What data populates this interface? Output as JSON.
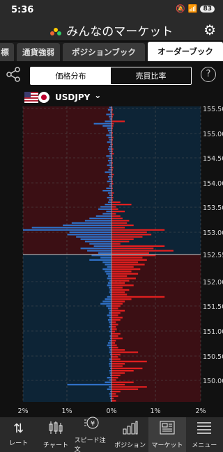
{
  "status": {
    "time": "5:36",
    "battery": "83"
  },
  "app": {
    "title": "みんなのマーケット"
  },
  "tabs": [
    {
      "label": "標"
    },
    {
      "label": "通貨強弱"
    },
    {
      "label": "ポジションブック"
    },
    {
      "label": "オーダーブック"
    }
  ],
  "segment": {
    "left": "価格分布",
    "right": "売買比率"
  },
  "pair": {
    "label": "USDJPY",
    "caret": "⌄"
  },
  "nav": [
    {
      "label": "レート",
      "icon": "rate-arrows-icon"
    },
    {
      "label": "チャート",
      "icon": "candlestick-icon"
    },
    {
      "label": "スピード注文",
      "icon": "yen-coin-icon"
    },
    {
      "label": "ポジション",
      "icon": "bars-icon"
    },
    {
      "label": "マーケット",
      "icon": "newspaper-icon"
    },
    {
      "label": "メニュー",
      "icon": "menu-icon"
    }
  ],
  "colors": {
    "sell_bar": "#2f6fc4",
    "buy_bar": "#e01f1f",
    "sell_bg_top": "#3b0f14",
    "sell_bg_bottom": "#0d2436"
  },
  "chart_data": {
    "type": "bar",
    "current_price": "152.55",
    "y_ticks": [
      "155.50",
      "155.00",
      "154.50",
      "154.00",
      "153.50",
      "153.00",
      "152.55",
      "152.00",
      "151.50",
      "151.00",
      "150.50",
      "150.00"
    ],
    "x_ticks": [
      "2%",
      "1%",
      "0%",
      "1%",
      "2%"
    ],
    "left_values": [
      0.05,
      0.08,
      0.03,
      0.12,
      0.06,
      0.04,
      0.15,
      0.4,
      0.2,
      0.1,
      0.08,
      0.05,
      0.12,
      0.07,
      0.05,
      0.1,
      0.03,
      0.06,
      0.08,
      0.05,
      0.04,
      0.12,
      0.06,
      0.08,
      0.05,
      0.1,
      0.04,
      0.07,
      0.15,
      0.05,
      0.08,
      0.06,
      0.1,
      0.04,
      0.05,
      0.12,
      0.2,
      0.08,
      0.05,
      0.1,
      0.06,
      0.08,
      0.15,
      0.25,
      0.3,
      0.12,
      0.2,
      0.35,
      0.5,
      0.6,
      0.9,
      1.1,
      1.8,
      2.0,
      0.95,
      1.0,
      0.8,
      0.7,
      0.6,
      0.5,
      0.4,
      0.7,
      0.55,
      0.3,
      0.45,
      0.25,
      0.5,
      0.2,
      0.15,
      0.1,
      0.2,
      0.15,
      0.12,
      0.08,
      0.1,
      0.05,
      0.08,
      0.1,
      0.06,
      0.04,
      0.05,
      0.03,
      0.1,
      0.15,
      0.2,
      0.25,
      0.12,
      0.08,
      0.05,
      0.06,
      0.1,
      0.05,
      0.08,
      0.06,
      0.04,
      0.06,
      0.03,
      0.05,
      0.02,
      0.04,
      0.03,
      0.05,
      0.08,
      0.1,
      0.06,
      0.04,
      0.05,
      0.03,
      0.02,
      0.05,
      0.04,
      0.06,
      0.05,
      0.03,
      0.05,
      0.04,
      0.03,
      0.1,
      0.05,
      0.15,
      1.0,
      0.06,
      0.1,
      0.03,
      0.05,
      0.04,
      0.03,
      0.02
    ],
    "right_values": [
      0.02,
      0.03,
      0.02,
      0.05,
      0.03,
      0.02,
      0.3,
      0.05,
      0.04,
      0.03,
      0.02,
      0.03,
      0.02,
      0.04,
      0.03,
      0.02,
      0.03,
      0.02,
      0.04,
      0.03,
      0.05,
      0.02,
      0.03,
      0.02,
      0.03,
      0.02,
      0.04,
      0.03,
      0.02,
      0.05,
      0.03,
      0.02,
      0.03,
      0.04,
      0.02,
      0.03,
      0.02,
      0.05,
      0.03,
      0.04,
      0.03,
      0.2,
      0.45,
      0.1,
      0.15,
      0.3,
      0.1,
      0.2,
      0.25,
      0.4,
      0.35,
      0.5,
      0.3,
      1.2,
      0.8,
      0.9,
      0.7,
      0.5,
      0.4,
      0.2,
      1.2,
      0.95,
      1.4,
      0.85,
      1.0,
      0.7,
      0.8,
      0.6,
      0.75,
      0.5,
      0.65,
      0.45,
      0.6,
      0.35,
      0.55,
      0.4,
      0.3,
      0.5,
      0.25,
      0.4,
      0.3,
      0.35,
      1.2,
      0.45,
      0.3,
      0.25,
      0.2,
      0.15,
      0.3,
      0.2,
      0.15,
      0.25,
      0.2,
      0.1,
      0.15,
      0.1,
      0.12,
      0.08,
      0.2,
      0.15,
      0.25,
      0.1,
      0.08,
      0.12,
      0.15,
      0.3,
      0.6,
      0.2,
      0.15,
      0.2,
      0.8,
      0.3,
      0.25,
      0.7,
      0.5,
      0.3,
      0.2,
      0.15,
      0.1,
      0.5,
      0.3,
      0.8,
      0.6,
      0.2,
      0.1,
      0.15,
      0.05,
      0.1
    ]
  }
}
